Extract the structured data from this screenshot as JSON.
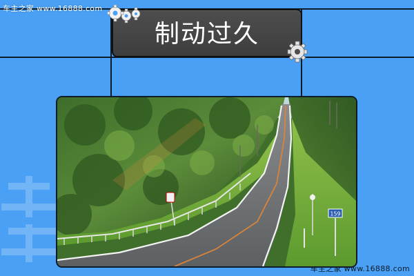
{
  "watermark": {
    "top_left": "车主之家    www.16888.com",
    "bottom_right": "车主之家  www.16888.com",
    "sign_number": "159"
  },
  "title": {
    "text": "制动过久"
  },
  "photo": {
    "subject": "winding-road-through-forest"
  },
  "colors": {
    "background": "#4aa0f4",
    "card": "#444444",
    "frame": "#0d1b2a",
    "title_text": "#ffffff"
  },
  "icons": {
    "top_left": "gears-icon",
    "title_corner": "gear-icon"
  }
}
